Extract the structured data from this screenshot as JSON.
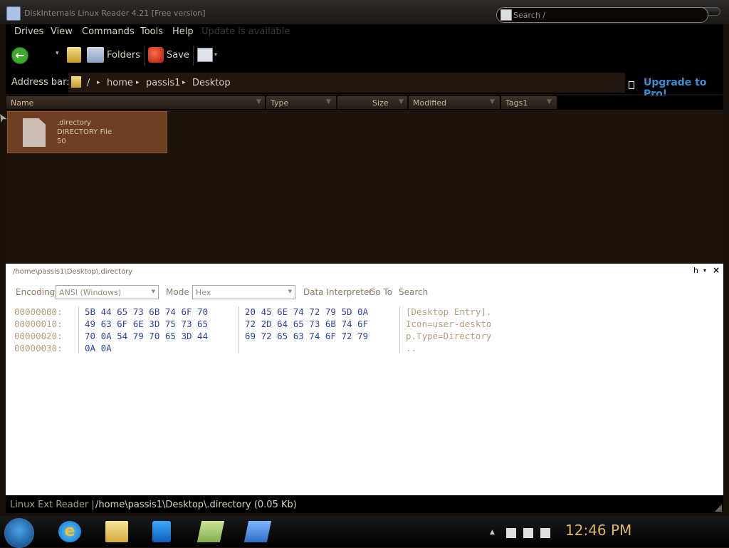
{
  "window": {
    "title": "DiskInternals Linux Reader 4.21 [Free version]"
  },
  "menu": {
    "items": [
      "Drives",
      "View",
      "Commands",
      "Tools",
      "Help"
    ],
    "update_notice": "Update is available"
  },
  "toolbar": {
    "folders_label": "Folders",
    "save_label": "Save",
    "search_placeholder": "Search /"
  },
  "address_bar": {
    "label": "Address bar:",
    "crumbs": [
      "/",
      "home",
      "passis1",
      "Desktop"
    ],
    "upgrade_label": "Upgrade to Pro!"
  },
  "columns": [
    "Name",
    "Type",
    "Size",
    "Modified",
    "Tags1"
  ],
  "files": [
    {
      "name": ".directory",
      "type": "DIRECTORY File",
      "size": "50"
    }
  ],
  "hex_viewer": {
    "path": "/home\\passis1\\Desktop\\.directory",
    "panel_letter": "h",
    "close_glyph": "×",
    "encoding_label": "Encoding",
    "encoding_value": "ANSI (Windows)",
    "mode_label": "Mode",
    "mode_value": "Hex",
    "data_interpreter": "Data Interpreter",
    "go_to": "Go To",
    "search": "Search",
    "rows": [
      {
        "offset": "00000000:",
        "left": "5B 44 65 73 6B 74 6F 70",
        "right": "20 45 6E 74 72 79 5D 0A",
        "text": "[Desktop Entry]."
      },
      {
        "offset": "00000010:",
        "left": "49 63 6F 6E 3D 75 73 65",
        "right": "72 2D 64 65 73 6B 74 6F",
        "text": "Icon=user-deskto"
      },
      {
        "offset": "00000020:",
        "left": "70 0A 54 79 70 65 3D 44",
        "right": "69 72 65 63 74 6F 72 79",
        "text": "p.Type=Directory"
      },
      {
        "offset": "00000030:",
        "left": "0A 0A",
        "right": "",
        "text": ".."
      }
    ]
  },
  "status": {
    "left": "Linux Ext Reader |",
    "path": "/home\\passis1\\Desktop\\.directory (0.05 Kb)"
  },
  "taskbar": {
    "clock": "12:46 PM",
    "ie_glyph": "e"
  },
  "colors": {
    "accent_link": "#3a8ed6",
    "hex_bytes": "#2f43a8",
    "hex_text": "#b3a07f",
    "selected_item": "#6e3f22",
    "clock": "#d8b56a"
  }
}
